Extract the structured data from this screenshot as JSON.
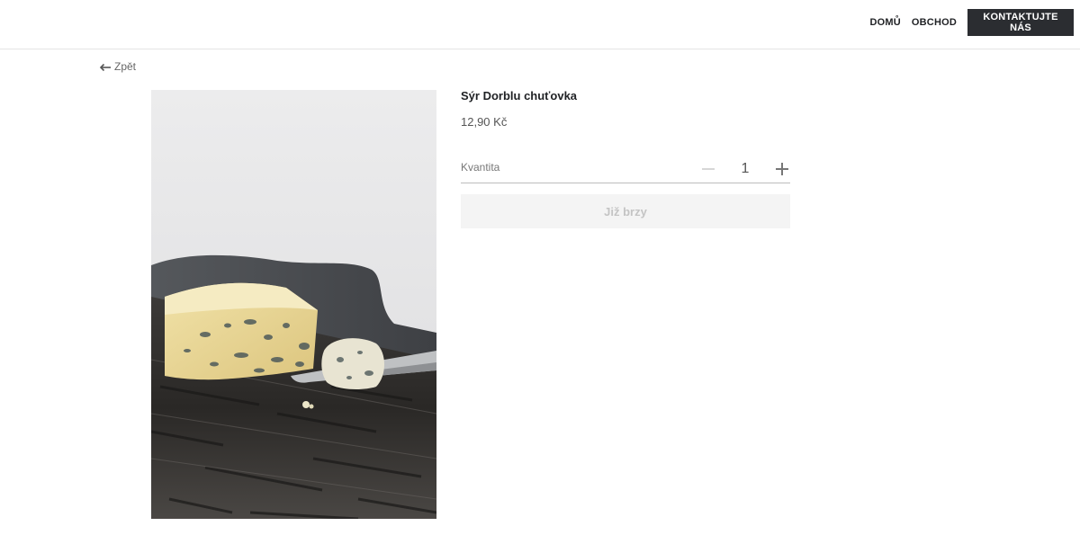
{
  "header": {
    "nav": [
      {
        "label": "DOMŮ"
      },
      {
        "label": "OBCHOD"
      }
    ],
    "contact_label": "KONTAKTUJTE NÁS"
  },
  "back": {
    "icon": "arrow-left-icon",
    "label": "Zpět"
  },
  "product": {
    "image": "blue-cheese-on-wooden-board-photo",
    "title": "Sýr Dorblu chuťovka",
    "price": "12,90 Kč",
    "quantity_label": "Kvantita",
    "quantity_value": "1",
    "decrement_icon": "minus-icon",
    "increment_icon": "plus-icon",
    "button_label": "Již brzy"
  },
  "colors": {
    "contact_bg": "#2b2d31",
    "button_bg": "#f4f4f4",
    "button_text": "#c4c4c4"
  }
}
